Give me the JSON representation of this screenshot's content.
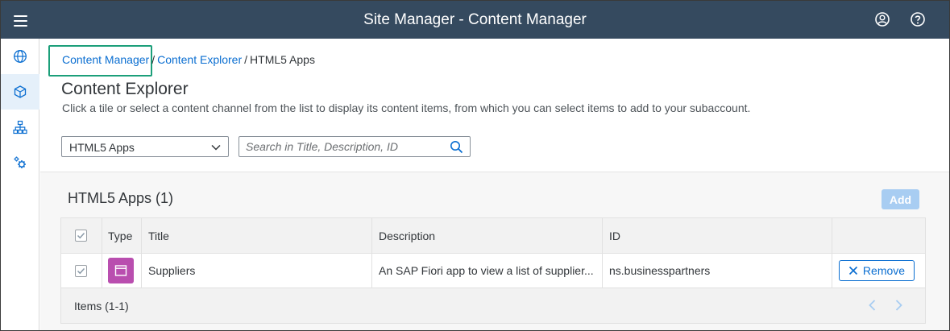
{
  "shell": {
    "title": "Site Manager - Content Manager",
    "icons": [
      "menu-icon",
      "user-icon",
      "help-icon"
    ],
    "bg_color": "#354a5f"
  },
  "sidenav": {
    "items": [
      {
        "name": "globe-icon",
        "active": false
      },
      {
        "name": "cube-icon",
        "active": true
      },
      {
        "name": "hierarchy-icon",
        "active": false
      },
      {
        "name": "gears-icon",
        "active": false
      }
    ]
  },
  "breadcrumb": {
    "items": [
      "Content Manager",
      "Content Explorer",
      "HTML5 Apps"
    ],
    "separator": "/"
  },
  "page": {
    "title": "Content Explorer",
    "subtitle": "Click a tile or select a content channel from the list to display its content items, from which you can select items to add to your subaccount."
  },
  "filters": {
    "channel_select": "HTML5 Apps",
    "search_placeholder": "Search in Title, Description, ID"
  },
  "table": {
    "title": "HTML5 Apps (1)",
    "add_label": "Add",
    "columns": [
      "Type",
      "Title",
      "Description",
      "ID"
    ],
    "rows": [
      {
        "title": "Suppliers",
        "description": "An SAP Fiori app to view a list of supplier...",
        "id": "ns.businesspartners",
        "action": "Remove",
        "type_icon": "app-window-icon"
      }
    ],
    "footer": "Items (1-1)"
  },
  "colors": {
    "link": "#0a6ed1",
    "highlight": "#1c9f7a",
    "type_badge": "#b94eaf",
    "add_disabled": "#a8cdf2"
  }
}
